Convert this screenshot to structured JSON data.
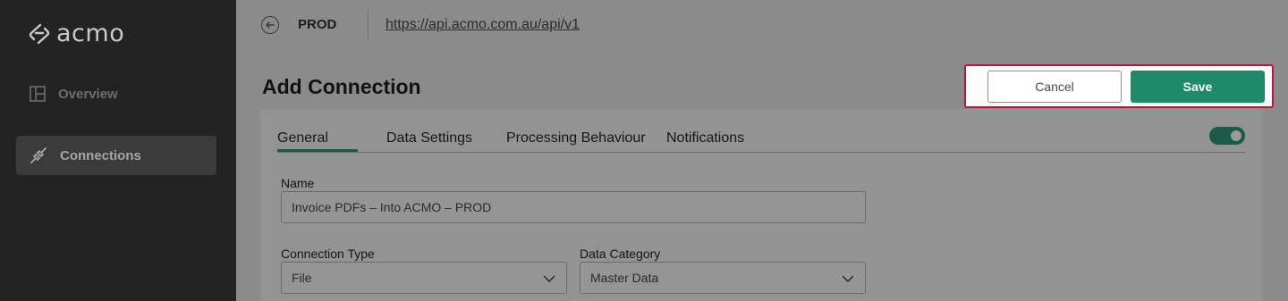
{
  "app": {
    "logo_text": "acmo"
  },
  "sidebar": {
    "items": [
      {
        "label": "Overview",
        "icon": "layout-icon",
        "active": false
      },
      {
        "label": "Connections",
        "icon": "plug-icon",
        "active": true
      }
    ]
  },
  "topbar": {
    "environment": "PROD",
    "api_url": "https://api.acmo.com.au/api/v1"
  },
  "page": {
    "title": "Add Connection"
  },
  "actions": {
    "cancel_label": "Cancel",
    "save_label": "Save"
  },
  "tabs": [
    {
      "label": "General",
      "active": true
    },
    {
      "label": "Data Settings",
      "active": false
    },
    {
      "label": "Processing Behaviour",
      "active": false
    },
    {
      "label": "Notifications",
      "active": false
    }
  ],
  "toggle": {
    "enabled": true
  },
  "form": {
    "name": {
      "label": "Name",
      "value": "Invoice PDFs – Into ACMO – PROD"
    },
    "connection_type": {
      "label": "Connection Type",
      "value": "File"
    },
    "data_category": {
      "label": "Data Category",
      "value": "Master Data"
    }
  },
  "colors": {
    "accent": "#1f8a6a",
    "highlight_border": "#b5173d",
    "sidebar_bg": "#232323"
  }
}
